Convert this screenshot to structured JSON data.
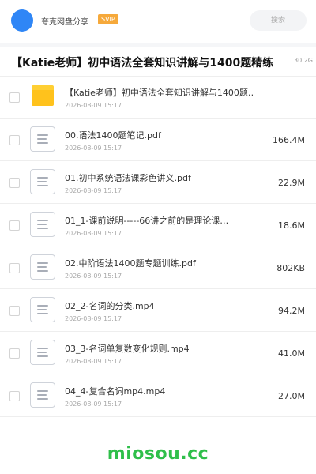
{
  "header": {
    "sharer_name": "夸克网盘分享",
    "badge": "SVIP",
    "search_placeholder": "搜索"
  },
  "share": {
    "title": "【Katie老师】初中语法全套知识讲解与1400题精练",
    "total_size": "30.2G"
  },
  "files": [
    {
      "type": "folder",
      "name": "【Katie老师】初中语法全套知识讲解与1400题…",
      "date": "2026-08-09 15:17",
      "size": ""
    },
    {
      "type": "file",
      "name": "00.语法1400题笔记.pdf",
      "date": "2026-08-09 15:17",
      "size": "166.4M"
    },
    {
      "type": "file",
      "name": "01.初中系统语法课彩色讲义.pdf",
      "date": "2026-08-09 15:17",
      "size": "22.9M"
    },
    {
      "type": "file",
      "name": "01_1-课前说明-----66讲之前的是理论课…",
      "date": "2026-08-09 15:17",
      "size": "18.6M"
    },
    {
      "type": "file",
      "name": "02.中阶语法1400题专题训练.pdf",
      "date": "2026-08-09 15:17",
      "size": "802KB"
    },
    {
      "type": "file",
      "name": "02_2-名词的分类.mp4",
      "date": "2026-08-09 15:17",
      "size": "94.2M"
    },
    {
      "type": "file",
      "name": "03_3-名词单复数变化规则.mp4",
      "date": "2026-08-09 15:17",
      "size": "41.0M"
    },
    {
      "type": "file",
      "name": "04_4-复合名词mp4.mp4",
      "date": "2026-08-09 15:17",
      "size": "27.0M"
    }
  ],
  "icons": {
    "folder": "folder-icon",
    "file": "document-icon"
  },
  "colors": {
    "avatar": "#2f86f6",
    "badge": "#f6a93b",
    "folder": "#ffc21c",
    "watermark": "#2fbf4a"
  },
  "watermark": "miosou.cc"
}
